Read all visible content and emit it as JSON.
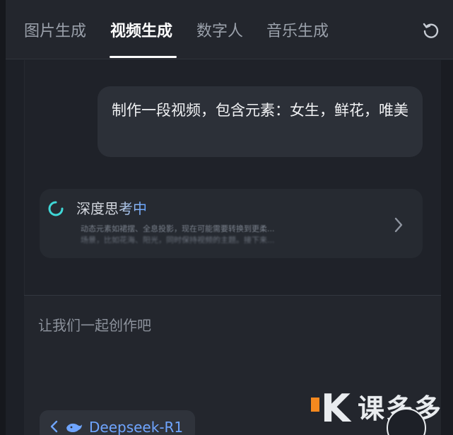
{
  "tabs": [
    {
      "label": "图片生成",
      "active": false
    },
    {
      "label": "视频生成",
      "active": true
    },
    {
      "label": "数字人",
      "active": false
    },
    {
      "label": "音乐生成",
      "active": false
    }
  ],
  "chat": {
    "user_message": "制作一段视频，包含元素：女生，鲜花，唯美",
    "thinking": {
      "title": "深度思考中",
      "preview_lines": [
        "动态元素如裙摆、全息投影，现在可能需要转换到更柔...",
        "场景，比如花海、阳光，同时保持视频的主题。接下来..."
      ]
    }
  },
  "composer": {
    "placeholder": "让我们一起创作吧"
  },
  "model_selector": {
    "label": "Deepseek-R1"
  },
  "watermark": {
    "letter": "K",
    "text": "课多多"
  },
  "icons": {
    "refresh": "refresh-icon",
    "spinner": "loading-spinner-icon",
    "chevron": "chevron-right-icon",
    "model_logo": "whale-icon"
  },
  "colors": {
    "accent_blue": "#5fa0ff",
    "spinner_cyan": "#3fd6d6",
    "watermark_orange": "#f5891f"
  }
}
